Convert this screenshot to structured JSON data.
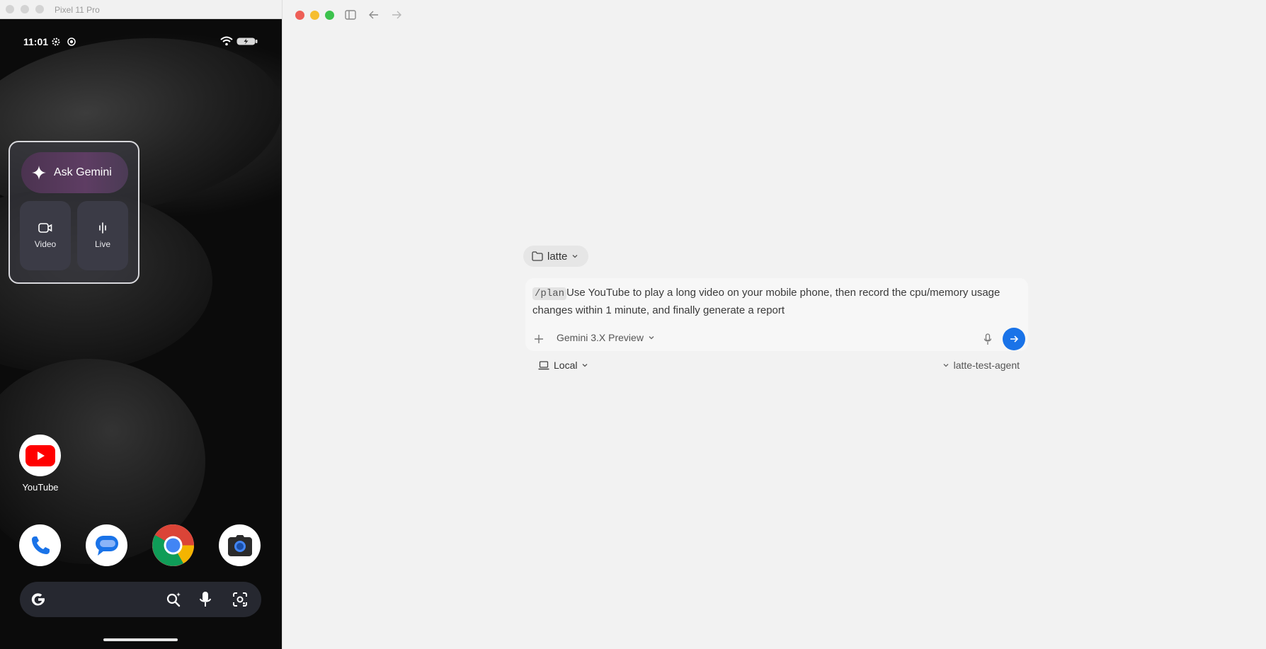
{
  "emulator": {
    "title": "Pixel 11 Pro",
    "status_time": "11:01",
    "gemini_widget": {
      "ask_label": "Ask Gemini",
      "video_label": "Video",
      "live_label": "Live"
    },
    "apps": {
      "youtube_label": "YouTube"
    },
    "colors": {
      "youtube_red": "#ff0000",
      "gemini_purple": "#5e3d63"
    }
  },
  "app": {
    "folder": {
      "label": "latte",
      "icon": "folder-icon"
    },
    "composer": {
      "command_tag": "/plan",
      "prompt_text": "Use YouTube to play a long video on your mobile phone, then record the cpu/memory usage changes within 1 minute, and finally generate a report",
      "add_icon": "plus-icon",
      "model_label": "Gemini 3.X Preview",
      "mic_icon": "microphone-icon",
      "send_icon": "arrow-right-icon"
    },
    "environment": {
      "label": "Local",
      "icon": "laptop-icon"
    },
    "agent": {
      "label": "latte-test-agent"
    },
    "colors": {
      "accent": "#1a73e8",
      "traffic_red": "#ee5f57",
      "traffic_yellow": "#f6be2f",
      "traffic_green": "#3cc24d"
    }
  }
}
